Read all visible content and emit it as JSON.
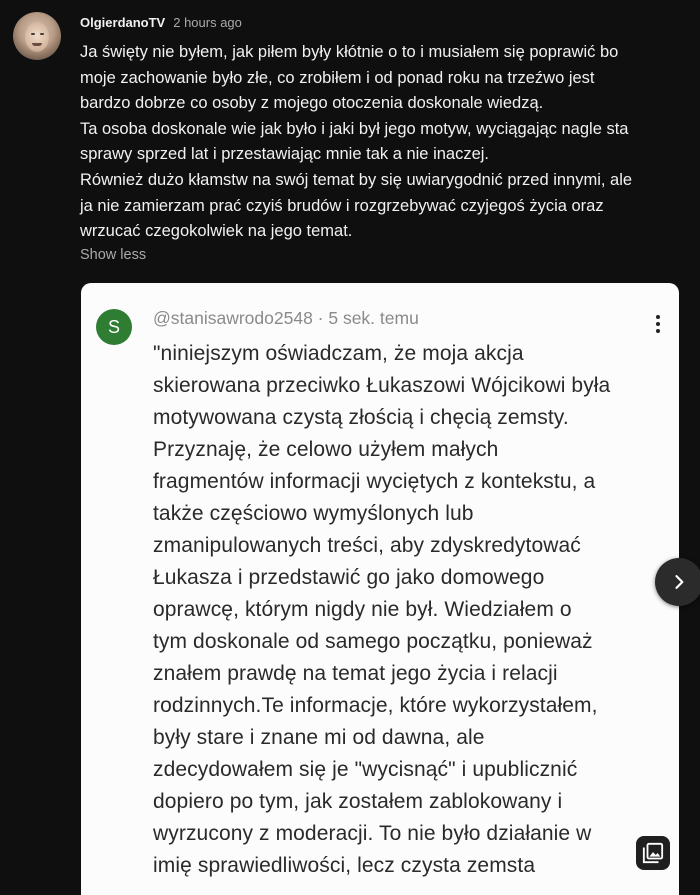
{
  "comment": {
    "author": "OlgierdanoTV",
    "time": "2 hours ago",
    "lines": [
      "Ja święty nie byłem, jak piłem były kłótnie o to i musiałem się poprawić bo",
      "moje zachowanie było złe, co zrobiłem i od ponad roku na trzeźwo jest",
      "bardzo dobrze co osoby z mojego otoczenia doskonale wiedzą.",
      "Ta osoba doskonale wie jak było i jaki był jego motyw, wyciągając nagle sta",
      "sprawy sprzed lat i przestawiając mnie tak a nie inaczej.",
      "Również dużo kłamstw na swój temat by się uwiarygodnić przed innymi, ale",
      "ja nie zamierzam prać czyiś brudów i rozgrzebywać czyjegoś życia oraz",
      "wrzucać czegokolwiek na jego temat."
    ],
    "show_less": "Show less"
  },
  "attachment": {
    "avatar_letter": "S",
    "handle_line": "@stanisawrodo2548 · 5 sek. temu",
    "body_lines": [
      "\"niniejszym oświadczam, że moja akcja",
      "skierowana przeciwko Łukaszowi Wójcikowi była",
      "motywowana czystą złością i chęcią zemsty.",
      "Przyznaję, że celowo użyłem małych",
      "fragmentów informacji wyciętych z kontekstu, a",
      "także częściowo wymyślonych lub",
      "zmanipulowanych treści, aby zdyskredytować",
      "Łukasza i przedstawić go jako domowego",
      "oprawcę, którym nigdy nie był. Wiedziałem o",
      "tym doskonale od samego początku, ponieważ",
      "znałem prawdę na temat jego życia i relacji",
      "rodzinnych.Te informacje, które wykorzystałem,",
      "były stare i znane mi od dawna, ale",
      "zdecydowałem się je \"wycisnąć\" i upublicznić",
      "dopiero po tym, jak zostałem zablokowany i",
      "wyrzucony z moderacji. To nie było działanie w",
      "imię sprawiedliwości, lecz czysta zemsta"
    ]
  },
  "colors": {
    "background": "#0f0f0f",
    "primary_text": "#f1f1f1",
    "secondary_text": "#aaaaaa",
    "card_background": "#fcfcfc",
    "s_avatar": "#2e7d32"
  },
  "icons": {
    "menu": "more-vert-icon",
    "gallery": "image-gallery-icon",
    "next": "chevron-right-icon"
  }
}
